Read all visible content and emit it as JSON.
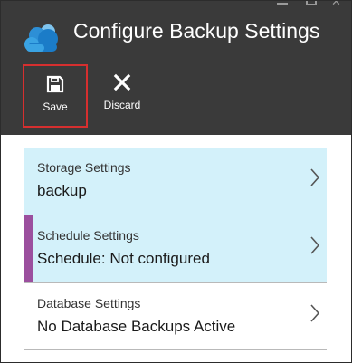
{
  "header": {
    "title": "Configure Backup Settings"
  },
  "toolbar": {
    "save_label": "Save",
    "discard_label": "Discard"
  },
  "settings": [
    {
      "label": "Storage Settings",
      "value": "backup"
    },
    {
      "label": "Schedule Settings",
      "value": "Schedule: Not configured"
    },
    {
      "label": "Database Settings",
      "value": "No Database Backups Active"
    }
  ],
  "colors": {
    "header_bg": "#3a3a3a",
    "highlight_row": "#d3f1fa",
    "selection_accent": "#9b4f9e",
    "save_outline": "#d62f2f"
  },
  "icons": {
    "brand": "cloud-icon",
    "save": "save-icon",
    "discard": "close-icon",
    "row_nav": "chevron-right-icon"
  }
}
